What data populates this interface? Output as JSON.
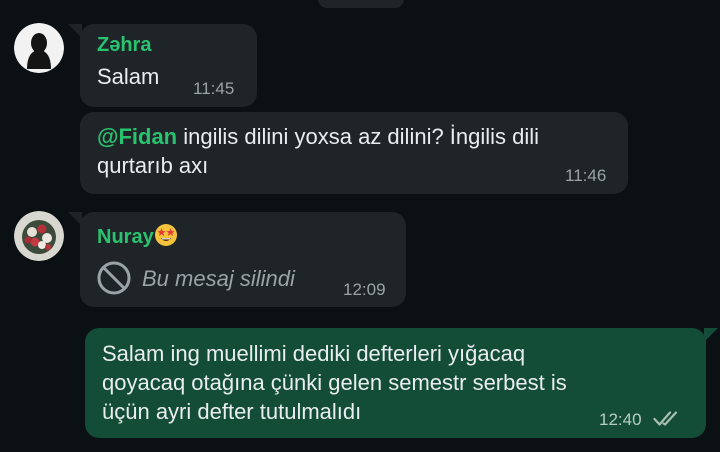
{
  "chat": {
    "messages": [
      {
        "sender": "Zəhra",
        "text": "Salam",
        "time": "11:45"
      },
      {
        "mention": "@Fidan",
        "text_line1": " ingilis dilini yoxsa az dilini? İngilis dili",
        "text_line2": "qurtarıb axı",
        "time": "11:46"
      },
      {
        "sender": "Nuray",
        "sender_emoji": "🤩",
        "deleted_text": "Bu mesaj silindi",
        "time": "12:09"
      },
      {
        "line1": "Salam ing muellimi dediki defterleri yığacaq",
        "line2": "qoyacaq otağına çünki gelen semestr serbest is",
        "line3": "üçün ayri defter tutulmalıdı",
        "time": "12:40",
        "status": "read"
      }
    ]
  },
  "icons": {
    "deleted": "block-icon",
    "read_receipt": "double-check-icon"
  },
  "colors": {
    "background": "#0b1014",
    "incoming_bubble": "#1f2428",
    "outgoing_bubble": "#134d37",
    "sender_name": "#29c36f",
    "read_receipt": "#a9bfb1"
  }
}
